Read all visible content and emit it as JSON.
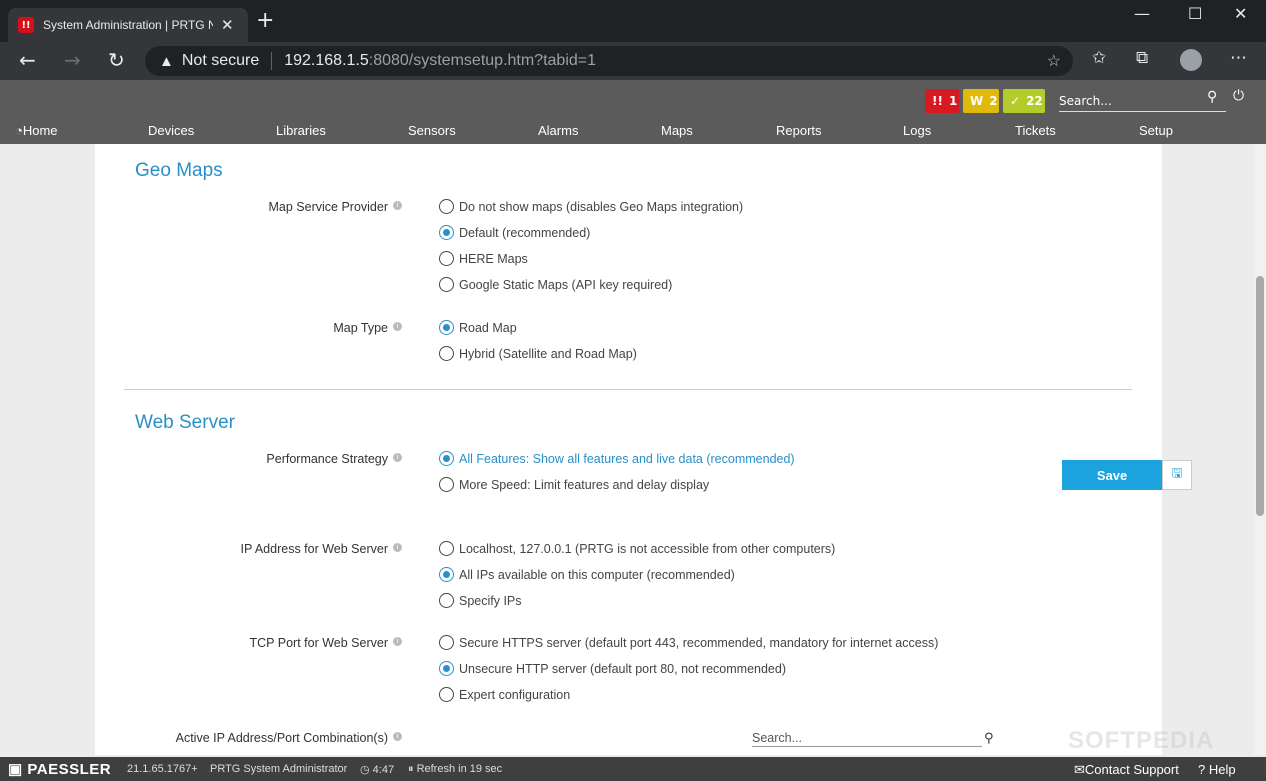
{
  "browser": {
    "tab_title": "System Administration | PRTG Ne",
    "tab_favicon": "PRTG",
    "security_label": "Not secure",
    "url_host": "192.168.1.5",
    "url_rest": ":8080/systemsetup.htm?tabid=1"
  },
  "header": {
    "alarm_red_count": "1",
    "alarm_yellow_label": "W",
    "alarm_yellow_count": "2",
    "alarm_green_count": "22",
    "search_placeholder": "Search...",
    "nav": [
      "Home",
      "Devices",
      "Libraries",
      "Sensors",
      "Alarms",
      "Maps",
      "Reports",
      "Logs",
      "Tickets",
      "Setup"
    ]
  },
  "geo": {
    "title": "Geo Maps",
    "provider_label": "Map Service Provider",
    "provider_options": [
      "Do not show maps (disables Geo Maps integration)",
      "Default (recommended)",
      "HERE Maps",
      "Google Static Maps (API key required)"
    ],
    "type_label": "Map Type",
    "type_options": [
      "Road Map",
      "Hybrid (Satellite and Road Map)"
    ]
  },
  "web": {
    "title": "Web Server",
    "perf_label": "Performance Strategy",
    "perf_options": [
      "All Features: Show all features and live data (recommended)",
      "More Speed: Limit features and delay display"
    ],
    "ip_label": "IP Address for Web Server",
    "ip_options": [
      "Localhost, 127.0.0.1 (PRTG is not accessible from other computers)",
      "All IPs available on this computer (recommended)",
      "Specify IPs"
    ],
    "port_label": "TCP Port for Web Server",
    "port_options": [
      "Secure HTTPS server (default port 443, recommended, mandatory for internet access)",
      "Unsecure HTTP server (default port 80, not recommended)",
      "Expert configuration"
    ],
    "combo_label": "Active IP Address/Port Combination(s)",
    "combo_search_placeholder": "Search..."
  },
  "actions": {
    "save_label": "Save"
  },
  "footer": {
    "brand": "PAESSLER",
    "version": "21.1.65.1767+",
    "user": "PRTG System Administrator",
    "time": "4:47",
    "refresh": "Refresh in 19 sec",
    "contact": "Contact Support",
    "help": "Help"
  },
  "watermark": "SOFTPEDIA"
}
